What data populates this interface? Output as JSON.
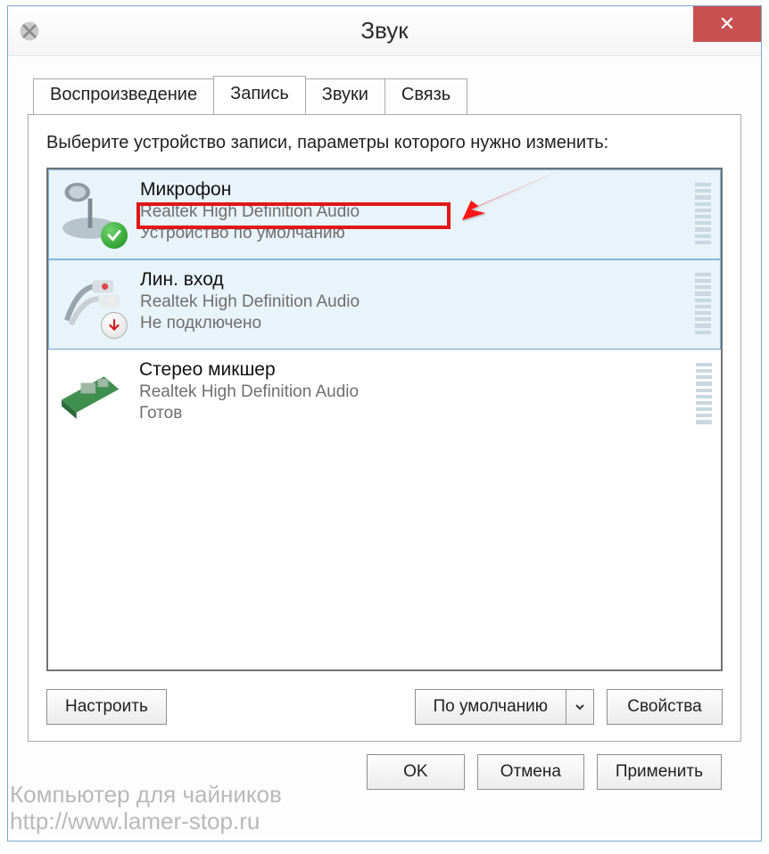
{
  "window": {
    "title": "Звук",
    "close_label": "✕"
  },
  "tabs": {
    "items": [
      {
        "label": "Воспроизведение"
      },
      {
        "label": "Запись"
      },
      {
        "label": "Звуки"
      },
      {
        "label": "Связь"
      }
    ],
    "active_index": 1
  },
  "instruction": "Выберите устройство записи, параметры которого нужно изменить:",
  "devices": [
    {
      "name": "Микрофон",
      "driver": "Realtek High Definition Audio",
      "status": "Устройство по умолчанию",
      "icon": "microphone-icon",
      "badge": "ok",
      "highlighted": true,
      "red_outlined_driver": true
    },
    {
      "name": "Лин. вход",
      "driver": "Realtek High Definition Audio",
      "status": "Не подключено",
      "icon": "line-in-icon",
      "badge": "down",
      "highlighted": true,
      "red_outlined_driver": false
    },
    {
      "name": "Стерео микшер",
      "driver": "Realtek High Definition Audio",
      "status": "Готов",
      "icon": "mixer-icon",
      "badge": null,
      "highlighted": false,
      "red_outlined_driver": false
    }
  ],
  "buttons": {
    "configure": "Настроить",
    "set_default": "По умолчанию",
    "properties": "Свойства",
    "ok": "OK",
    "cancel": "Отмена",
    "apply": "Применить"
  },
  "watermark": "Компьютер для чайников\nhttp://www.lamer-stop.ru"
}
